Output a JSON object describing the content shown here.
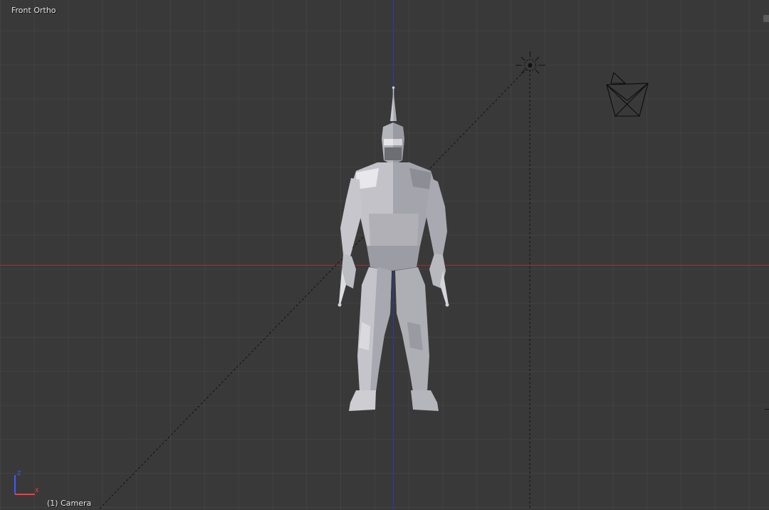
{
  "viewport": {
    "view_name": "Front Ortho",
    "active_object": "(1) Camera",
    "background_color": "#393939",
    "x_axis_color": "#a33a3a",
    "z_axis_color": "#2d3ea8"
  },
  "scene": {
    "objects": [
      {
        "name": "character-mesh-icon",
        "kind": "mesh"
      },
      {
        "name": "lamp-icon",
        "kind": "light"
      },
      {
        "name": "camera-icon",
        "kind": "camera"
      }
    ]
  },
  "axis_gizmo": {
    "z_label": "Z",
    "x_label": "X",
    "z_color": "#3d5bff",
    "x_color": "#ff3b3b"
  }
}
